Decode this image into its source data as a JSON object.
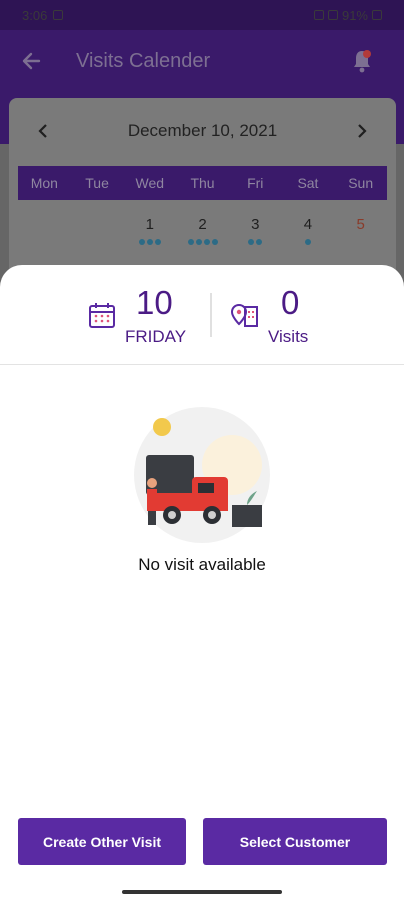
{
  "status_bar": {
    "time": "3:06",
    "battery": "91%"
  },
  "app_bar": {
    "title": "Visits Calender"
  },
  "calendar": {
    "month_label": "December 10, 2021",
    "weekdays": [
      "Mon",
      "Tue",
      "Wed",
      "Thu",
      "Fri",
      "Sat",
      "Sun"
    ],
    "days": [
      {
        "num": "",
        "dots": 0
      },
      {
        "num": "",
        "dots": 0
      },
      {
        "num": "1",
        "dots": 3
      },
      {
        "num": "2",
        "dots": 4
      },
      {
        "num": "3",
        "dots": 2
      },
      {
        "num": "4",
        "dots": 1
      },
      {
        "num": "5",
        "dots": 0
      }
    ]
  },
  "summary": {
    "date_number": "10",
    "day_name": "FRIDAY",
    "visits_count": "0",
    "visits_label": "Visits"
  },
  "empty_state": {
    "message": "No visit available"
  },
  "actions": {
    "create_label": "Create Other Visit",
    "select_label": "Select Customer"
  },
  "icons": {
    "back": "arrow-left-icon",
    "notifications": "bell-icon",
    "calendar": "calendar-icon",
    "visits": "location-building-icon"
  },
  "colors": {
    "primary": "#5a2aa3",
    "accent_text": "#4b1b85",
    "appbar": "#3a1a6a"
  }
}
